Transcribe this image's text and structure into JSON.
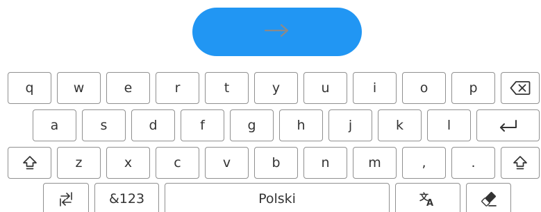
{
  "submit": {
    "icon": "arrow-right-icon",
    "color": "#2196f3",
    "icon_color": "#8a8a8a"
  },
  "keyboard": {
    "row1": [
      "q",
      "w",
      "e",
      "r",
      "t",
      "y",
      "u",
      "i",
      "o",
      "p"
    ],
    "row2": [
      "a",
      "s",
      "d",
      "f",
      "g",
      "h",
      "j",
      "k",
      "l"
    ],
    "row3": [
      "z",
      "x",
      "c",
      "v",
      "b",
      "n",
      "m",
      ",",
      "."
    ],
    "switch_label": "&123",
    "space_label": "Polski",
    "icons": {
      "backspace": "backspace-icon",
      "enter": "enter-icon",
      "shift": "shift-icon",
      "keyboard_switch": "keyboard-switch-icon",
      "translate": "translate-icon",
      "erase": "eraser-icon"
    },
    "border_color": "#8f8f8f",
    "text_color": "#333333"
  }
}
